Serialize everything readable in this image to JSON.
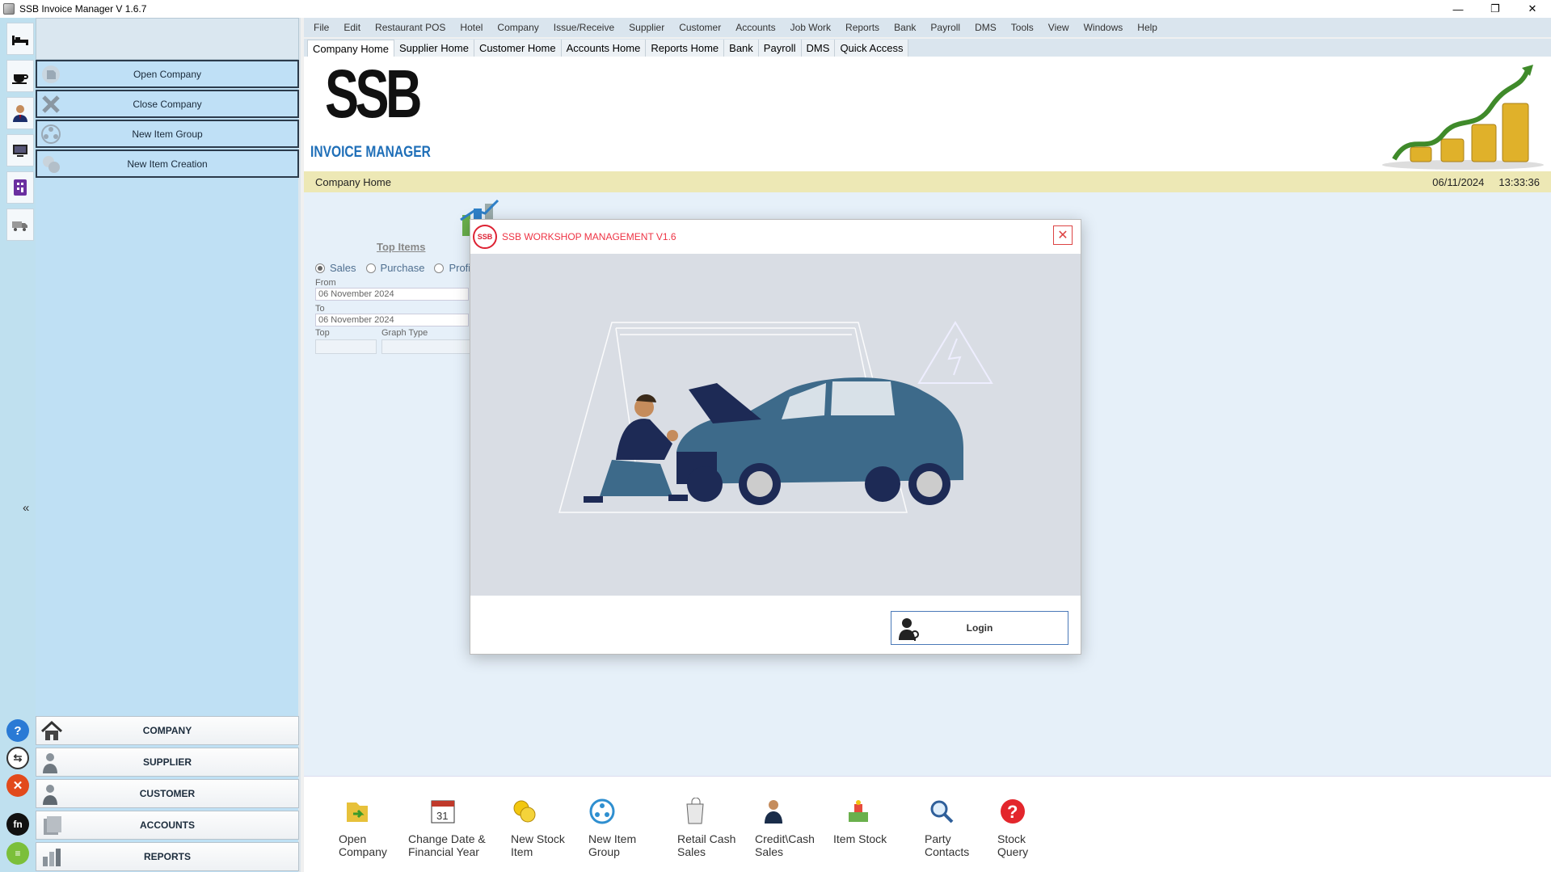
{
  "window": {
    "title": "SSB Invoice Manager V 1.6.7",
    "minimize": "—",
    "maximize": "❐",
    "close": "✕"
  },
  "menubar": [
    "File",
    "Edit",
    "Restaurant POS",
    "Hotel",
    "Company",
    "Issue/Receive",
    "Supplier",
    "Customer",
    "Accounts",
    "Job Work",
    "Reports",
    "Bank",
    "Payroll",
    "DMS",
    "Tools",
    "View",
    "Windows",
    "Help"
  ],
  "tabs": [
    "Company Home",
    "Supplier Home",
    "Customer Home",
    "Accounts Home",
    "Reports Home",
    "Bank",
    "Payroll",
    "DMS",
    "Quick Access"
  ],
  "left_menu": [
    "Open Company",
    "Close Company",
    "New Item Group",
    "New Item Creation"
  ],
  "left_nav": [
    "COMPANY",
    "SUPPLIER",
    "CUSTOMER",
    "ACCOUNTS",
    "REPORTS"
  ],
  "collapse_label": "«",
  "logo": {
    "main": "SSB",
    "sub": "INVOICE MANAGER"
  },
  "home_bar": {
    "title": "Company Home",
    "date": "06/11/2024",
    "time": "13:33:36"
  },
  "top_items": {
    "link": "Top Items",
    "radios": [
      "Sales",
      "Purchase",
      "Profit"
    ],
    "from_label": "From",
    "from_value": "06 November 2024",
    "to_label": "To",
    "to_value": "06 November 2024",
    "top_label": "Top",
    "graph_label": "Graph Type"
  },
  "dialog": {
    "logo_text": "SSB",
    "title": "SSB WORKSHOP MANAGEMENT V1.6",
    "close": "✕",
    "login": "Login"
  },
  "quick_access": [
    [
      "Open",
      "Company"
    ],
    [
      "Change Date &",
      "Financial Year"
    ],
    [
      "New Stock",
      "Item"
    ],
    [
      "New Item",
      "Group"
    ],
    [
      "Retail Cash",
      "Sales"
    ],
    [
      "Credit\\Cash",
      "Sales"
    ],
    [
      "Item Stock",
      ""
    ],
    [
      "Party",
      "Contacts"
    ],
    [
      "Stock",
      "Query"
    ]
  ],
  "colors": {
    "accent": "#1f6fb8",
    "dialog_title": "#e34444",
    "home_bar": "#ede8b5",
    "left_panel": "#bfe0f4"
  }
}
